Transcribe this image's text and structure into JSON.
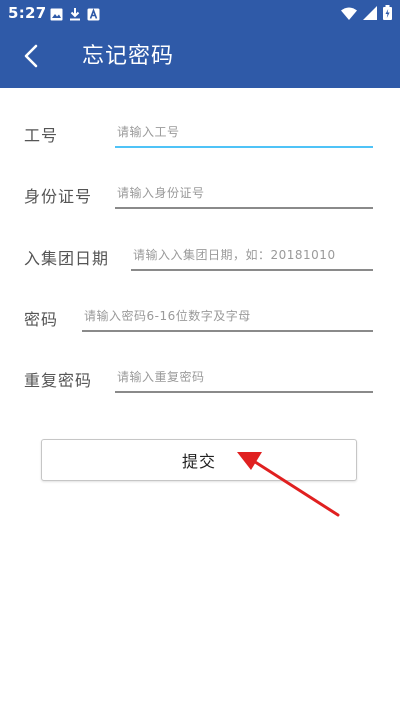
{
  "status_bar": {
    "time": "5:27",
    "left_icons": [
      "image-icon",
      "download-icon",
      "notification-a-icon"
    ],
    "right_icons": [
      "wifi-icon",
      "signal-icon",
      "battery-charging-icon"
    ]
  },
  "app_bar": {
    "title": "忘记密码",
    "back_icon": "chevron-left-icon",
    "background": "#2f5aa8"
  },
  "form": {
    "fields": [
      {
        "label": "工号",
        "placeholder": "请输入工号",
        "value": "",
        "focused": true
      },
      {
        "label": "身份证号",
        "placeholder": "请输入身份证号",
        "value": ""
      },
      {
        "label": "入集团日期",
        "placeholder": "请输入入集团日期，如：20181010",
        "value": ""
      },
      {
        "label": "密码",
        "placeholder": "请输入密码6-16位数字及字母",
        "value": ""
      },
      {
        "label": "重复密码",
        "placeholder": "请输入重复密码",
        "value": ""
      }
    ],
    "submit_label": "提交"
  },
  "colors": {
    "accent": "#2f5aa8",
    "focus_underline": "#4fc3f7",
    "annotation_arrow": "#e02020"
  }
}
